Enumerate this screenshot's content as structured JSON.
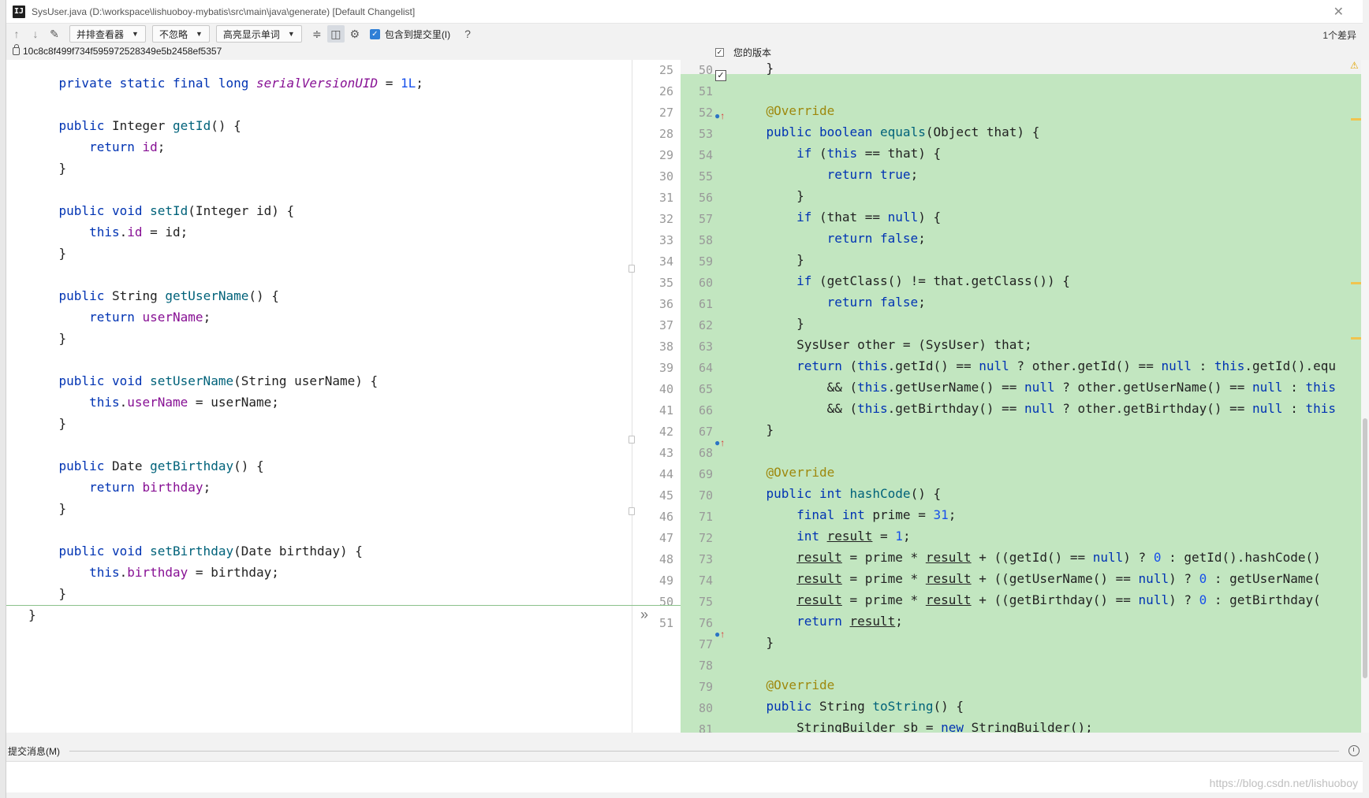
{
  "window": {
    "title": "SysUser.java (D:\\workspace\\lishuoboy-mybatis\\src\\main\\java\\generate) [Default Changelist]",
    "app_icon_text": "IJ"
  },
  "toolbar": {
    "viewer_dropdown": "并排查看器",
    "ignore_dropdown": "不忽略",
    "highlight_dropdown": "高亮显示单词",
    "include_commit_label": "包含到提交里(I)",
    "help_label": "?",
    "diff_count": "1个差异"
  },
  "revision": {
    "hash": "10c8c8f499f734f595972528349e5b2458ef5357",
    "right_label": "您的版本"
  },
  "left_line_numbers": [
    "25",
    "26",
    "27",
    "28",
    "29",
    "30",
    "31",
    "32",
    "33",
    "34",
    "35",
    "36",
    "37",
    "38",
    "39",
    "40",
    "41",
    "42",
    "43",
    "44",
    "45",
    "46",
    "47",
    "48",
    "49",
    "50",
    "51"
  ],
  "right_line_numbers": [
    "50",
    "51",
    "52",
    "53",
    "54",
    "55",
    "56",
    "57",
    "58",
    "59",
    "60",
    "61",
    "62",
    "63",
    "64",
    "65",
    "66",
    "67",
    "68",
    "69",
    "70",
    "71",
    "72",
    "73",
    "74",
    "75",
    "76",
    "77",
    "78",
    "79",
    "80",
    "81"
  ],
  "left_code": [
    [
      {
        "t": "    "
      },
      {
        "t": "private static final long ",
        "c": "kw"
      },
      {
        "t": "serialVersionUID",
        "c": "fldi"
      },
      {
        "t": " = "
      },
      {
        "t": "1L",
        "c": "num"
      },
      {
        "t": ";"
      }
    ],
    [],
    [
      {
        "t": "    "
      },
      {
        "t": "public ",
        "c": "kw"
      },
      {
        "t": "Integer "
      },
      {
        "t": "getId",
        "c": "mth"
      },
      {
        "t": "() {"
      }
    ],
    [
      {
        "t": "        "
      },
      {
        "t": "return ",
        "c": "kw"
      },
      {
        "t": "id",
        "c": "fld"
      },
      {
        "t": ";"
      }
    ],
    [
      {
        "t": "    }"
      }
    ],
    [],
    [
      {
        "t": "    "
      },
      {
        "t": "public void ",
        "c": "kw"
      },
      {
        "t": "setId",
        "c": "mth"
      },
      {
        "t": "(Integer id) {"
      }
    ],
    [
      {
        "t": "        "
      },
      {
        "t": "this",
        "c": "kw"
      },
      {
        "t": "."
      },
      {
        "t": "id",
        "c": "fld"
      },
      {
        "t": " = id;"
      }
    ],
    [
      {
        "t": "    }"
      }
    ],
    [],
    [
      {
        "t": "    "
      },
      {
        "t": "public ",
        "c": "kw"
      },
      {
        "t": "String "
      },
      {
        "t": "getUserName",
        "c": "mth"
      },
      {
        "t": "() {"
      }
    ],
    [
      {
        "t": "        "
      },
      {
        "t": "return ",
        "c": "kw"
      },
      {
        "t": "userName",
        "c": "fld"
      },
      {
        "t": ";"
      }
    ],
    [
      {
        "t": "    }"
      }
    ],
    [],
    [
      {
        "t": "    "
      },
      {
        "t": "public void ",
        "c": "kw"
      },
      {
        "t": "setUserName",
        "c": "mth"
      },
      {
        "t": "(String userName) {"
      }
    ],
    [
      {
        "t": "        "
      },
      {
        "t": "this",
        "c": "kw"
      },
      {
        "t": "."
      },
      {
        "t": "userName",
        "c": "fld"
      },
      {
        "t": " = userName;"
      }
    ],
    [
      {
        "t": "    }"
      }
    ],
    [],
    [
      {
        "t": "    "
      },
      {
        "t": "public ",
        "c": "kw"
      },
      {
        "t": "Date "
      },
      {
        "t": "getBirthday",
        "c": "mth"
      },
      {
        "t": "() {"
      }
    ],
    [
      {
        "t": "        "
      },
      {
        "t": "return ",
        "c": "kw"
      },
      {
        "t": "birthday",
        "c": "fld"
      },
      {
        "t": ";"
      }
    ],
    [
      {
        "t": "    }"
      }
    ],
    [],
    [
      {
        "t": "    "
      },
      {
        "t": "public void ",
        "c": "kw"
      },
      {
        "t": "setBirthday",
        "c": "mth"
      },
      {
        "t": "(Date birthday) {"
      }
    ],
    [
      {
        "t": "        "
      },
      {
        "t": "this",
        "c": "kw"
      },
      {
        "t": "."
      },
      {
        "t": "birthday",
        "c": "fld"
      },
      {
        "t": " = birthday;"
      }
    ],
    [
      {
        "t": "    }"
      }
    ],
    [
      {
        "t": "}"
      }
    ]
  ],
  "right_code": [
    [
      {
        "t": "    }"
      }
    ],
    [],
    [
      {
        "t": "    "
      },
      {
        "t": "@Override",
        "c": "ann"
      }
    ],
    [
      {
        "t": "    "
      },
      {
        "t": "public boolean ",
        "c": "kw"
      },
      {
        "t": "equals",
        "c": "mth"
      },
      {
        "t": "(Object that) {"
      }
    ],
    [
      {
        "t": "        "
      },
      {
        "t": "if ",
        "c": "kw"
      },
      {
        "t": "("
      },
      {
        "t": "this",
        "c": "kw"
      },
      {
        "t": " == that) {"
      }
    ],
    [
      {
        "t": "            "
      },
      {
        "t": "return true",
        "c": "kw"
      },
      {
        "t": ";"
      }
    ],
    [
      {
        "t": "        }"
      }
    ],
    [
      {
        "t": "        "
      },
      {
        "t": "if ",
        "c": "kw"
      },
      {
        "t": "(that == "
      },
      {
        "t": "null",
        "c": "kw"
      },
      {
        "t": ") {"
      }
    ],
    [
      {
        "t": "            "
      },
      {
        "t": "return false",
        "c": "kw"
      },
      {
        "t": ";"
      }
    ],
    [
      {
        "t": "        }"
      }
    ],
    [
      {
        "t": "        "
      },
      {
        "t": "if ",
        "c": "kw"
      },
      {
        "t": "(getClass() != that.getClass()) {"
      }
    ],
    [
      {
        "t": "            "
      },
      {
        "t": "return false",
        "c": "kw"
      },
      {
        "t": ";"
      }
    ],
    [
      {
        "t": "        }"
      }
    ],
    [
      {
        "t": "        SysUser other = (SysUser) that;"
      }
    ],
    [
      {
        "t": "        "
      },
      {
        "t": "return ",
        "c": "kw"
      },
      {
        "t": "("
      },
      {
        "t": "this",
        "c": "kw"
      },
      {
        "t": ".getId() == "
      },
      {
        "t": "null",
        "c": "kw"
      },
      {
        "t": " ? other.getId() == "
      },
      {
        "t": "null",
        "c": "kw"
      },
      {
        "t": " : "
      },
      {
        "t": "this",
        "c": "kw"
      },
      {
        "t": ".getId().equ"
      }
    ],
    [
      {
        "t": "            && ("
      },
      {
        "t": "this",
        "c": "kw"
      },
      {
        "t": ".getUserName() == "
      },
      {
        "t": "null",
        "c": "kw"
      },
      {
        "t": " ? other.getUserName() == "
      },
      {
        "t": "null",
        "c": "kw"
      },
      {
        "t": " : "
      },
      {
        "t": "this",
        "c": "kw"
      }
    ],
    [
      {
        "t": "            && ("
      },
      {
        "t": "this",
        "c": "kw"
      },
      {
        "t": ".getBirthday() == "
      },
      {
        "t": "null",
        "c": "kw"
      },
      {
        "t": " ? other.getBirthday() == "
      },
      {
        "t": "null",
        "c": "kw"
      },
      {
        "t": " : "
      },
      {
        "t": "this",
        "c": "kw"
      }
    ],
    [
      {
        "t": "    }"
      }
    ],
    [],
    [
      {
        "t": "    "
      },
      {
        "t": "@Override",
        "c": "ann"
      }
    ],
    [
      {
        "t": "    "
      },
      {
        "t": "public int ",
        "c": "kw"
      },
      {
        "t": "hashCode",
        "c": "mth"
      },
      {
        "t": "() {"
      }
    ],
    [
      {
        "t": "        "
      },
      {
        "t": "final int ",
        "c": "kw"
      },
      {
        "t": "prime = "
      },
      {
        "t": "31",
        "c": "num"
      },
      {
        "t": ";"
      }
    ],
    [
      {
        "t": "        "
      },
      {
        "t": "int ",
        "c": "kw"
      },
      {
        "t": "result",
        "c": "ul"
      },
      {
        "t": " = "
      },
      {
        "t": "1",
        "c": "num"
      },
      {
        "t": ";"
      }
    ],
    [
      {
        "t": "        "
      },
      {
        "t": "result",
        "c": "ul"
      },
      {
        "t": " = prime * "
      },
      {
        "t": "result",
        "c": "ul"
      },
      {
        "t": " + ((getId() == "
      },
      {
        "t": "null",
        "c": "kw"
      },
      {
        "t": ") ? "
      },
      {
        "t": "0",
        "c": "num"
      },
      {
        "t": " : getId().hashCode()"
      }
    ],
    [
      {
        "t": "        "
      },
      {
        "t": "result",
        "c": "ul"
      },
      {
        "t": " = prime * "
      },
      {
        "t": "result",
        "c": "ul"
      },
      {
        "t": " + ((getUserName() == "
      },
      {
        "t": "null",
        "c": "kw"
      },
      {
        "t": ") ? "
      },
      {
        "t": "0",
        "c": "num"
      },
      {
        "t": " : getUserName("
      }
    ],
    [
      {
        "t": "        "
      },
      {
        "t": "result",
        "c": "ul"
      },
      {
        "t": " = prime * "
      },
      {
        "t": "result",
        "c": "ul"
      },
      {
        "t": " + ((getBirthday() == "
      },
      {
        "t": "null",
        "c": "kw"
      },
      {
        "t": ") ? "
      },
      {
        "t": "0",
        "c": "num"
      },
      {
        "t": " : getBirthday("
      }
    ],
    [
      {
        "t": "        "
      },
      {
        "t": "return ",
        "c": "kw"
      },
      {
        "t": "result",
        "c": "ul"
      },
      {
        "t": ";"
      }
    ],
    [
      {
        "t": "    }"
      }
    ],
    [],
    [
      {
        "t": "    "
      },
      {
        "t": "@Override",
        "c": "ann"
      }
    ],
    [
      {
        "t": "    "
      },
      {
        "t": "public ",
        "c": "kw"
      },
      {
        "t": "String "
      },
      {
        "t": "toString",
        "c": "mth"
      },
      {
        "t": "() {"
      }
    ],
    [
      {
        "t": "        StringBuilder sb = "
      },
      {
        "t": "new ",
        "c": "kw"
      },
      {
        "t": "StringBuilder();"
      }
    ]
  ],
  "bottom": {
    "commit_message_label": "提交消息(M)",
    "watermark": "https://blog.csdn.net/lishuoboy"
  },
  "colors": {
    "added_bg": "#c2e6c0",
    "keyword": "#0033b3",
    "field": "#871094",
    "method": "#00627a",
    "number": "#1750eb",
    "annotation": "#9e880d"
  },
  "icons": [
    "app-icon",
    "up-arrow-icon",
    "down-arrow-icon",
    "edit-icon",
    "collapse-icon",
    "side-by-side-icon",
    "gear-icon",
    "lock-icon",
    "checkbox-icon",
    "override-marker-icon",
    "warning-icon",
    "merge-arrow-icon",
    "clock-icon",
    "close-icon"
  ]
}
